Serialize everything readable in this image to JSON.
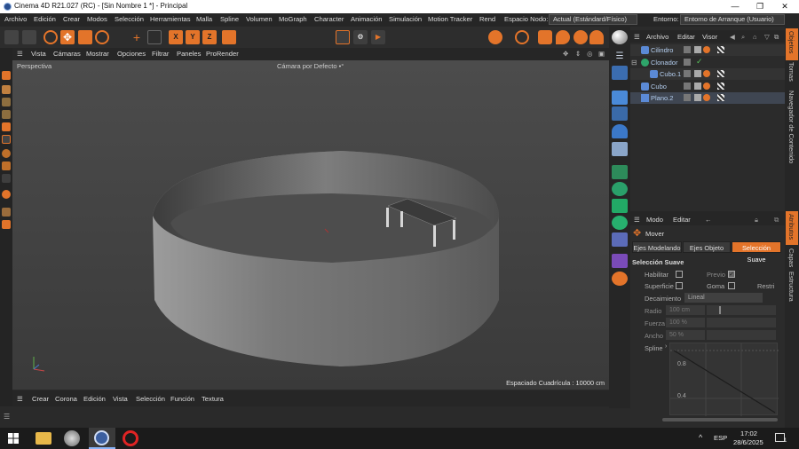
{
  "window": {
    "title": "Cinema 4D R21.027 (RC) - [Sin Nombre 1 *] - Principal",
    "minimize": "—",
    "restore": "❐",
    "close": "✕"
  },
  "menubar": {
    "items": [
      "Archivo",
      "Edición",
      "Crear",
      "Modos",
      "Selección",
      "Herramientas",
      "Malla",
      "Spline",
      "Volumen",
      "MoGraph",
      "Character",
      "Animación",
      "Simulación",
      "Motion Tracker",
      "Rend"
    ],
    "node_space_label": "Espacio Nodo:",
    "node_space_value": "Actual (Estándard/Físico)",
    "env_label": "Entorno:",
    "env_value": "Entorno de Arranque (Usuario)"
  },
  "toolbar": {
    "axis_x": "X",
    "axis_y": "Y",
    "axis_z": "Z"
  },
  "viewport": {
    "menu": [
      "Vista",
      "Cámaras",
      "Mostrar",
      "Opciones",
      "Filtrar",
      "Paneles",
      "ProRender"
    ],
    "label": "Perspectiva",
    "camera": "Cámara por Defecto",
    "camera_mark": "•°",
    "grid": "Espaciado Cuadrícula : 10000 cm"
  },
  "bottom": {
    "menu": [
      "Crear",
      "Corona",
      "Edición",
      "Vista",
      "Selección",
      "Función",
      "Textura"
    ]
  },
  "objects": {
    "menu": [
      "Archivo",
      "Editar",
      "Visor"
    ],
    "rows": [
      {
        "name": "Cilindro",
        "icon": "cylinder-icon"
      },
      {
        "name": "Clonador",
        "icon": "cloner-icon"
      },
      {
        "name": "Cubo.1",
        "icon": "cube-icon"
      },
      {
        "name": "Cubo",
        "icon": "cube-icon"
      },
      {
        "name": "Plano.2",
        "icon": "plane-icon"
      }
    ]
  },
  "attributes": {
    "menu": [
      "Modo",
      "Editar"
    ],
    "tool": "Mover",
    "tabs": [
      "Ejes Modelando",
      "Ejes Objeto",
      "Selección Suave"
    ],
    "section": "Selección Suave",
    "habilitar": "Habilitar",
    "previo": "Previo",
    "superficie": "Superficie",
    "goma": "Goma",
    "restringir": "Restri",
    "decaimiento_label": "Decaimiento",
    "decaimiento_value": "Lineal",
    "radio_label": "Radio",
    "radio_value": "100 cm",
    "fuerza_label": "Fuerza",
    "fuerza_value": "100 %",
    "ancho_label": "Ancho",
    "ancho_value": "50 %",
    "spline_label": "Spline",
    "graph_ticks": [
      "0.8",
      "0.4"
    ]
  },
  "sidetabs": [
    "Objetos",
    "Tomas",
    "Navegador de Contenido",
    "Atributos",
    "Capas",
    "Estructura"
  ],
  "taskbar": {
    "lang": "ESP",
    "time": "17:02",
    "date": "28/6/2025",
    "notif_count": "1"
  },
  "colors": {
    "accent": "#e3742a",
    "title_bg": "#ffffff",
    "object_text": "#b4ceef",
    "tab_active": "#e3742a"
  }
}
